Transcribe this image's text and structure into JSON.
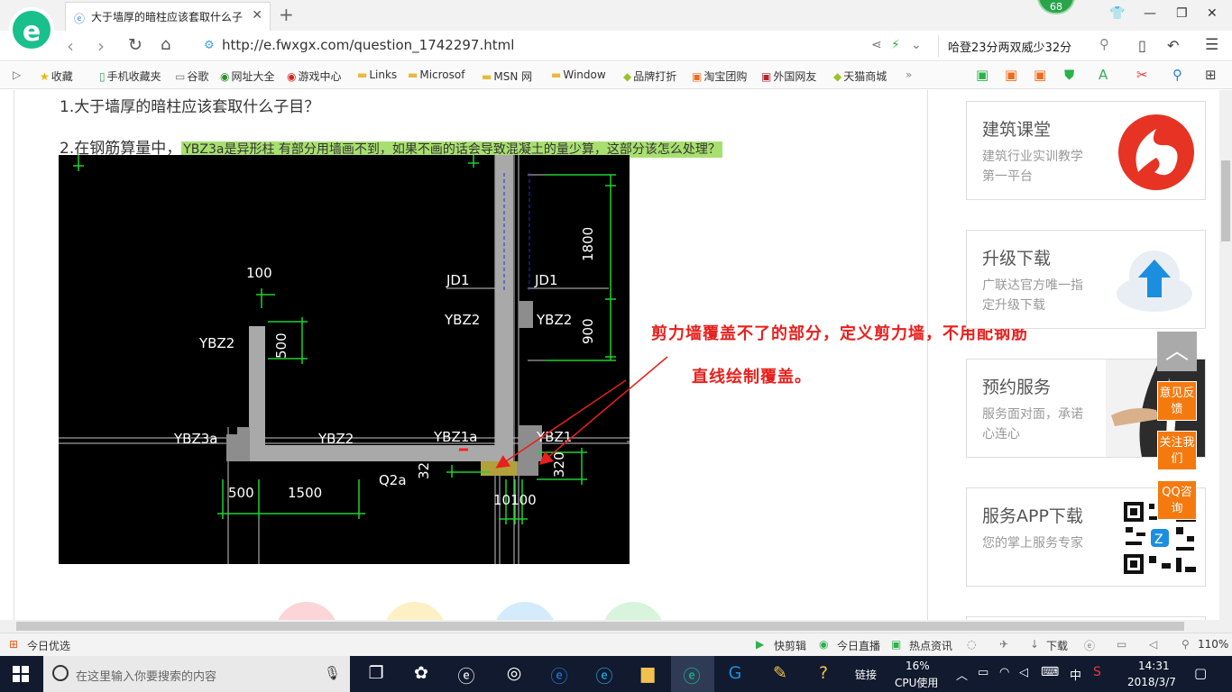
{
  "browser": {
    "logo_letter": "e",
    "tab_title": "大于墙厚的暗柱应该套取什么子目",
    "notif_count": "68",
    "url": "http://e.fwxgx.com/question_1742297.html",
    "search_text": "哈登23分两双威少32分"
  },
  "bookmarks": [
    {
      "icon": "★",
      "label": "收藏",
      "color": "#f3b400"
    },
    {
      "icon": "▯",
      "label": "手机收藏夹",
      "color": "#3aa05a"
    },
    {
      "icon": "▭",
      "label": "谷歌",
      "color": "#777"
    },
    {
      "icon": "◉",
      "label": "网址大全",
      "color": "#2d8e2d"
    },
    {
      "icon": "◉",
      "label": "游戏中心",
      "color": "#d22"
    },
    {
      "icon": "▬",
      "label": "Links",
      "color": "#e9b93d"
    },
    {
      "icon": "▬",
      "label": "Microsof",
      "color": "#e9b93d"
    },
    {
      "icon": "▬",
      "label": "MSN 网",
      "color": "#e9b93d"
    },
    {
      "icon": "▬",
      "label": "Window",
      "color": "#e9b93d"
    },
    {
      "icon": "◆",
      "label": "品牌打折",
      "color": "#9ac32a"
    },
    {
      "icon": "▣",
      "label": "淘宝团购",
      "color": "#f26a1b"
    },
    {
      "icon": "▣",
      "label": "外国网友",
      "color": "#b3262c"
    },
    {
      "icon": "◆",
      "label": "天猫商城",
      "color": "#9ac32a"
    }
  ],
  "article": {
    "q1": "1.大于墙厚的暗柱应该套取什么子目？",
    "q2_prefix": "2.在钢筋算量中，",
    "q2_highlight": "YBZ3a是异形柱   有部分用墙画不到，如果不画的话会导致混凝土的量少算，这部分该怎么处理？",
    "annotation_line1": "剪力墙覆盖不了的部分，定义剪力墙，不用配钢筋",
    "annotation_line2": "直线绘制覆盖。"
  },
  "cad_labels": {
    "dim100": "100",
    "dim1800": "1800",
    "dim900": "900",
    "dim500v": "500",
    "jd1_left": "JD1",
    "jd1_right": "JD1",
    "ybz2_upper_left": "YBZ2",
    "ybz2_upper_right": "YBZ2",
    "ybz2_left": "YBZ2",
    "ybz3a": "YBZ3a",
    "ybz2_bottom": "YBZ2",
    "ybz1a": "YBZ1a",
    "ybz1": "YBZ1",
    "q2a": "Q2a",
    "dim32": "32",
    "dim320": "320",
    "dim500h": "500",
    "dim1500": "1500",
    "dim100_bottom": "10100"
  },
  "sidebar_cards": [
    {
      "title": "建筑课堂",
      "desc": "建筑行业实训教学第一平台",
      "icon": "flame-logo-icon"
    },
    {
      "title": "升级下载",
      "desc": "广联达官方唯一指定升级下载",
      "icon": "cloud-upload-icon"
    },
    {
      "title": "预约服务",
      "desc": "服务面对面，承诺心连心",
      "icon": "handshake-photo-icon"
    },
    {
      "title": "服务APP下载",
      "desc": "您的掌上服务专家",
      "icon": "qr-code-icon"
    }
  ],
  "float_buttons": [
    "意见反馈",
    "关注我们",
    "QQ咨询"
  ],
  "statusbar": {
    "left": "今日优选",
    "items": [
      "快剪辑",
      "今日直播",
      "热点资讯"
    ],
    "download": "下载",
    "zoom": "110%"
  },
  "taskbar": {
    "search_placeholder": "在这里输入你要搜索的内容",
    "links": "链接",
    "cpu_pct": "16%",
    "cpu_label": "CPU使用",
    "ime": "中",
    "time": "14:31",
    "date": "2018/3/7"
  },
  "colors": {
    "accent": "#19c08c",
    "annotation": "#e8201d",
    "highlight": "#a8e06f",
    "float_orange": "#f47a10",
    "cad_green": "#1bd32f"
  }
}
